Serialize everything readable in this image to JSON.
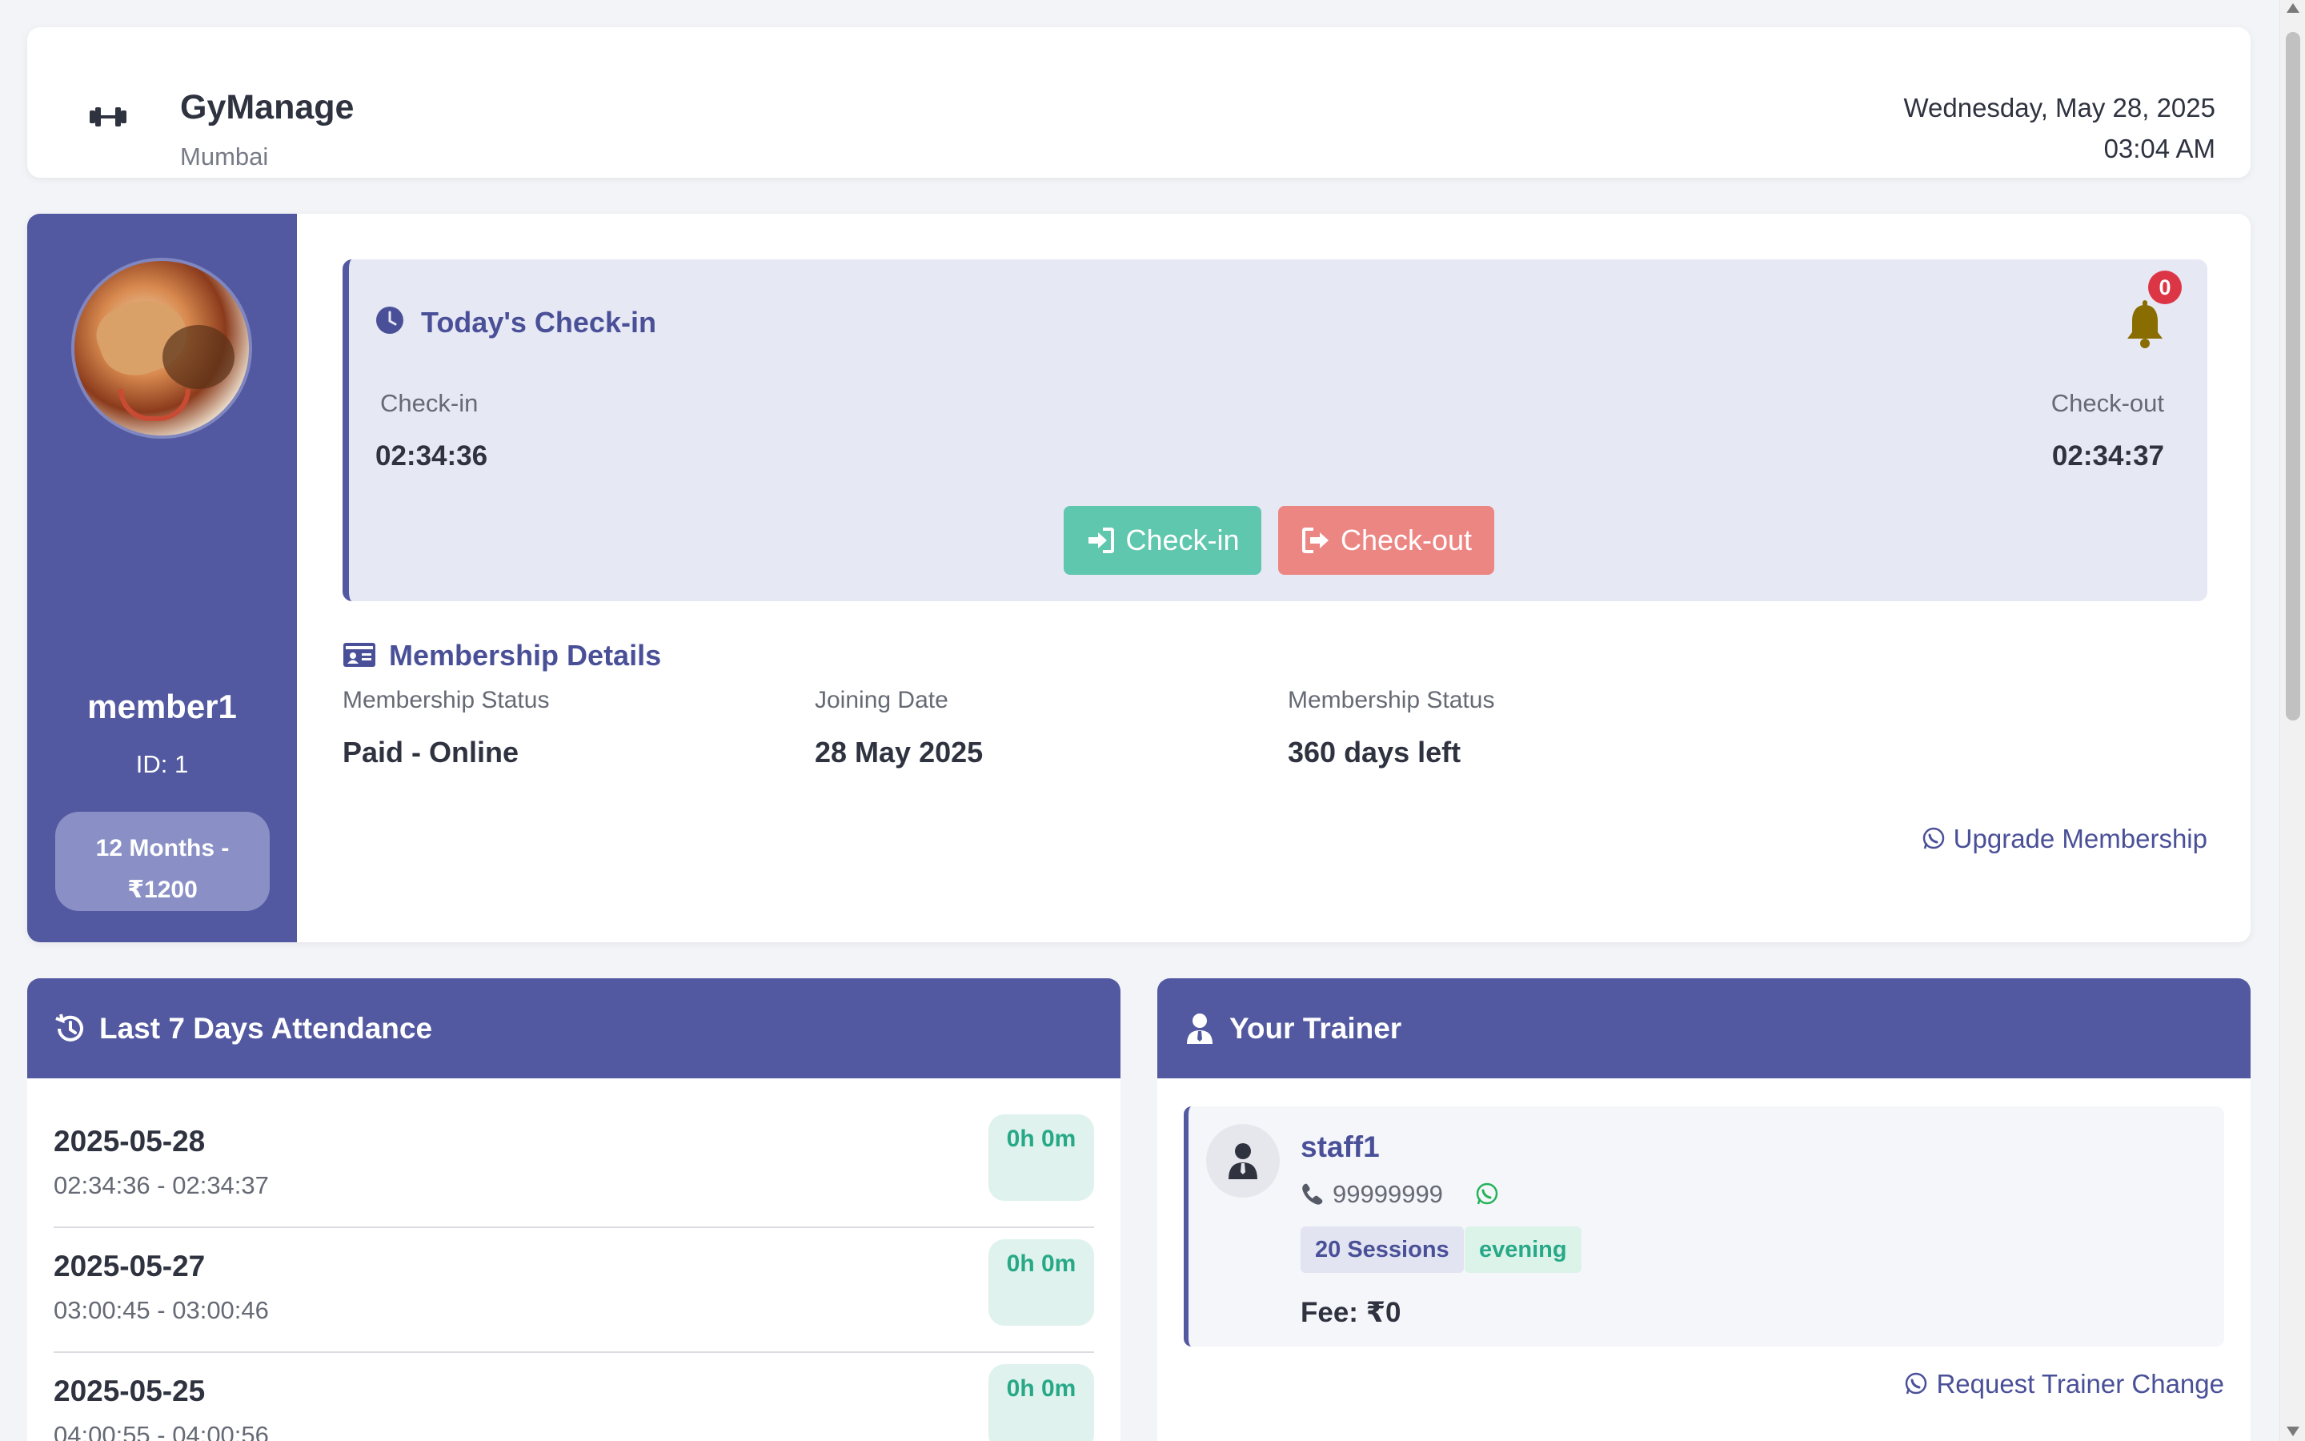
{
  "header": {
    "app_name": "GyManage",
    "location": "Mumbai",
    "date": "Wednesday, May 28, 2025",
    "time": "03:04 AM",
    "logo_icon": "dumbbell-icon"
  },
  "profile": {
    "username": "member1",
    "id_text": "ID: 1",
    "plan": "12 Months - ₹1200"
  },
  "checkin": {
    "title": "Today's Check-in",
    "notification_count": "0",
    "checkin_label": "Check-in",
    "checkin_time": "02:34:36",
    "checkout_label": "Check-out",
    "checkout_time": "02:34:37",
    "checkin_button": "Check-in",
    "checkout_button": "Check-out",
    "colors": {
      "checkin": "#5ec7ad",
      "checkout": "#ec8683",
      "accent": "#5359a0"
    }
  },
  "membership": {
    "title": "Membership Details",
    "status_label": "Membership Status",
    "status_value": "Paid - Online",
    "joining_label": "Joining Date",
    "joining_value": "28 May 2025",
    "remaining_label": "Membership Status",
    "remaining_value": "360 days left",
    "upgrade_link": "Upgrade Membership"
  },
  "attendance": {
    "title": "Last 7 Days Attendance",
    "rows": [
      {
        "date": "2025-05-28",
        "times": "02:34:36 - 02:34:37",
        "duration": "0h 0m"
      },
      {
        "date": "2025-05-27",
        "times": "03:00:45 - 03:00:46",
        "duration": "0h 0m"
      },
      {
        "date": "2025-05-25",
        "times": "04:00:55 - 04:00:56",
        "duration": "0h 0m"
      }
    ]
  },
  "trainer": {
    "title": "Your Trainer",
    "name": "staff1",
    "phone": "99999999",
    "sessions": "20 Sessions",
    "shift": "evening",
    "fee": "Fee: ₹0",
    "request_change": "Request Trainer Change"
  }
}
